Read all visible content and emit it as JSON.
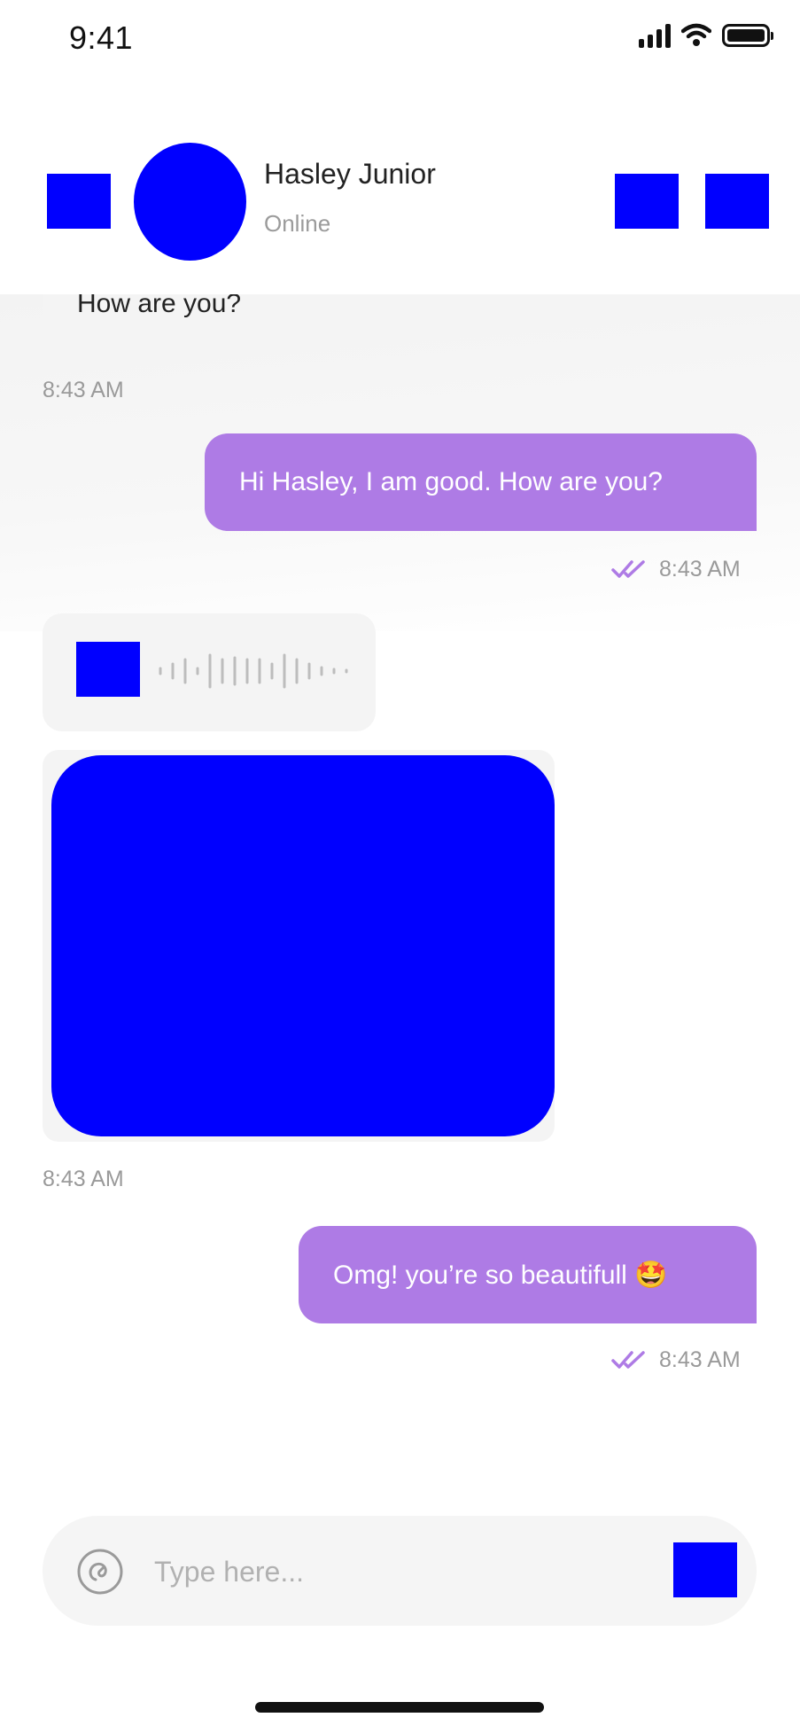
{
  "status_bar": {
    "time": "9:41",
    "icons": [
      "signal-icon",
      "wifi-icon",
      "battery-icon"
    ]
  },
  "header": {
    "contact_name": "Hasley Junior",
    "contact_status": "Online",
    "icons": [
      "back-icon",
      "avatar-image",
      "call-icon",
      "video-call-icon"
    ]
  },
  "messages": [
    {
      "direction": "incoming",
      "type": "text",
      "text": "How are you?",
      "time": "8:43 AM"
    },
    {
      "direction": "outgoing",
      "type": "text",
      "text": "Hi Hasley, I am good. How are you?",
      "time": "8:43 AM",
      "read": true
    },
    {
      "direction": "incoming",
      "type": "voice",
      "icon": "play-icon"
    },
    {
      "direction": "incoming",
      "type": "image",
      "icon": "photo-image",
      "time": "8:43 AM"
    },
    {
      "direction": "outgoing",
      "type": "text",
      "text": "Omg! you’re so beautifull 🤩",
      "time": "8:43 AM",
      "read": true
    }
  ],
  "composer": {
    "placeholder": "Type here...",
    "icons": [
      "attach-icon",
      "send-icon"
    ]
  },
  "colors": {
    "accent": "#AE7BE5",
    "bubble_incoming": "#F4F4F4",
    "muted_text": "#9A9A9A",
    "placeholder_block": "#0000FF"
  }
}
